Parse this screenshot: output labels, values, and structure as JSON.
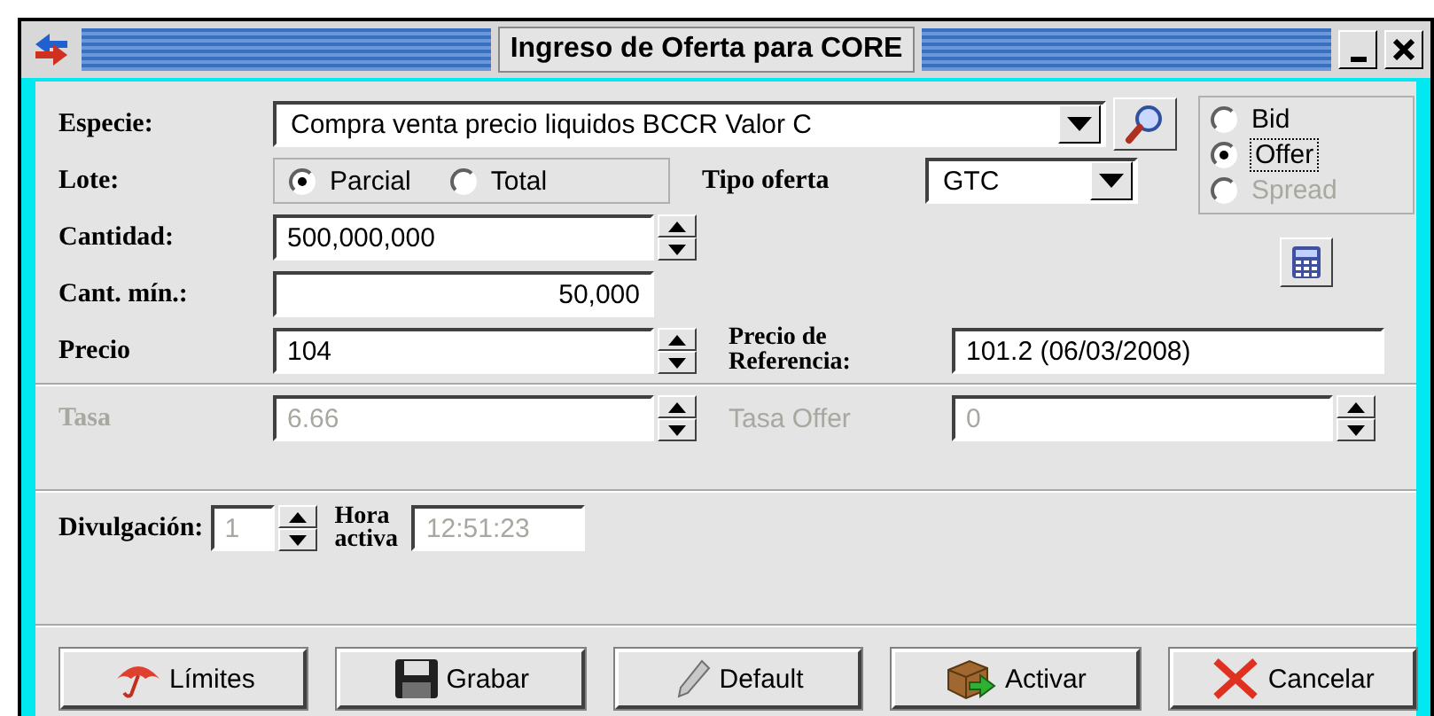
{
  "window": {
    "title": "Ingreso de Oferta para CORE"
  },
  "especie": {
    "label": "Especie:",
    "value": "Compra venta precio liquidos BCCR Valor C"
  },
  "side_options": [
    {
      "label": "Bid",
      "selected": false,
      "disabled": false,
      "focused": false
    },
    {
      "label": "Offer",
      "selected": true,
      "disabled": false,
      "focused": true
    },
    {
      "label": "Spread",
      "selected": false,
      "disabled": true,
      "focused": false
    }
  ],
  "lote": {
    "label": "Lote:",
    "options": [
      {
        "label": "Parcial",
        "selected": true
      },
      {
        "label": "Total",
        "selected": false
      }
    ]
  },
  "tipo_oferta": {
    "label": "Tipo oferta",
    "value": "GTC"
  },
  "cantidad": {
    "label": "Cantidad:",
    "value": "500,000,000",
    "disabled": false
  },
  "cant_min": {
    "label": "Cant. mín.:",
    "value": "50,000"
  },
  "precio": {
    "label": "Precio",
    "value": "104",
    "disabled": false
  },
  "precio_referencia": {
    "label_lines": [
      "Precio de",
      "Referencia:"
    ],
    "value": "101.2 (06/03/2008)"
  },
  "tasa": {
    "label": "Tasa",
    "value": "6.66",
    "disabled": true
  },
  "tasa_offer": {
    "label": "Tasa Offer",
    "value": "0",
    "disabled": true
  },
  "divulgacion": {
    "label": "Divulgación:",
    "value": "1",
    "disabled": true
  },
  "hora_activa": {
    "label_lines": [
      "Hora",
      "activa"
    ],
    "value": "12:51:23",
    "disabled": true
  },
  "buttons": [
    {
      "kind": "limits",
      "label": "Límites"
    },
    {
      "kind": "save",
      "label": "Grabar"
    },
    {
      "kind": "default",
      "label": "Default"
    },
    {
      "kind": "activate",
      "label": "Activar"
    },
    {
      "kind": "cancel",
      "label": "Cancelar"
    }
  ]
}
